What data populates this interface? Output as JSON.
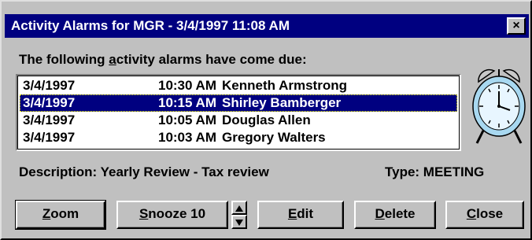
{
  "window": {
    "title": "Activity Alarms for MGR - 3/4/1997  11:08 AM",
    "close_glyph": "×"
  },
  "prompt": {
    "before": "The following ",
    "accel": "a",
    "after": "ctivity alarms have come due:"
  },
  "alarms": [
    {
      "date": "3/4/1997",
      "time": "10:30 AM",
      "name": "Kenneth Armstrong",
      "selected": false
    },
    {
      "date": "3/4/1997",
      "time": "10:15 AM",
      "name": "Shirley Bamberger",
      "selected": true
    },
    {
      "date": "3/4/1997",
      "time": "10:05 AM",
      "name": "Douglas Allen",
      "selected": false
    },
    {
      "date": "3/4/1997",
      "time": "10:03 AM",
      "name": "Gregory Walters",
      "selected": false
    }
  ],
  "description": "Description: Yearly Review - Tax review",
  "type": "Type: MEETING",
  "buttons": {
    "zoom": {
      "accel": "Z",
      "rest": "oom"
    },
    "snooze": {
      "accel": "S",
      "rest": "nooze 10"
    },
    "edit": {
      "accel": "E",
      "rest": "dit"
    },
    "delete": {
      "accel": "D",
      "rest": "elete"
    },
    "close": {
      "accel": "C",
      "rest": "lose"
    }
  },
  "icons": {
    "clock": "alarm-clock-icon",
    "spin_up": "spin-up-arrow-icon",
    "spin_down": "spin-down-arrow-icon"
  },
  "colors": {
    "titlebar": "#000080",
    "selection": "#000080",
    "face": "#c0c0c0"
  }
}
